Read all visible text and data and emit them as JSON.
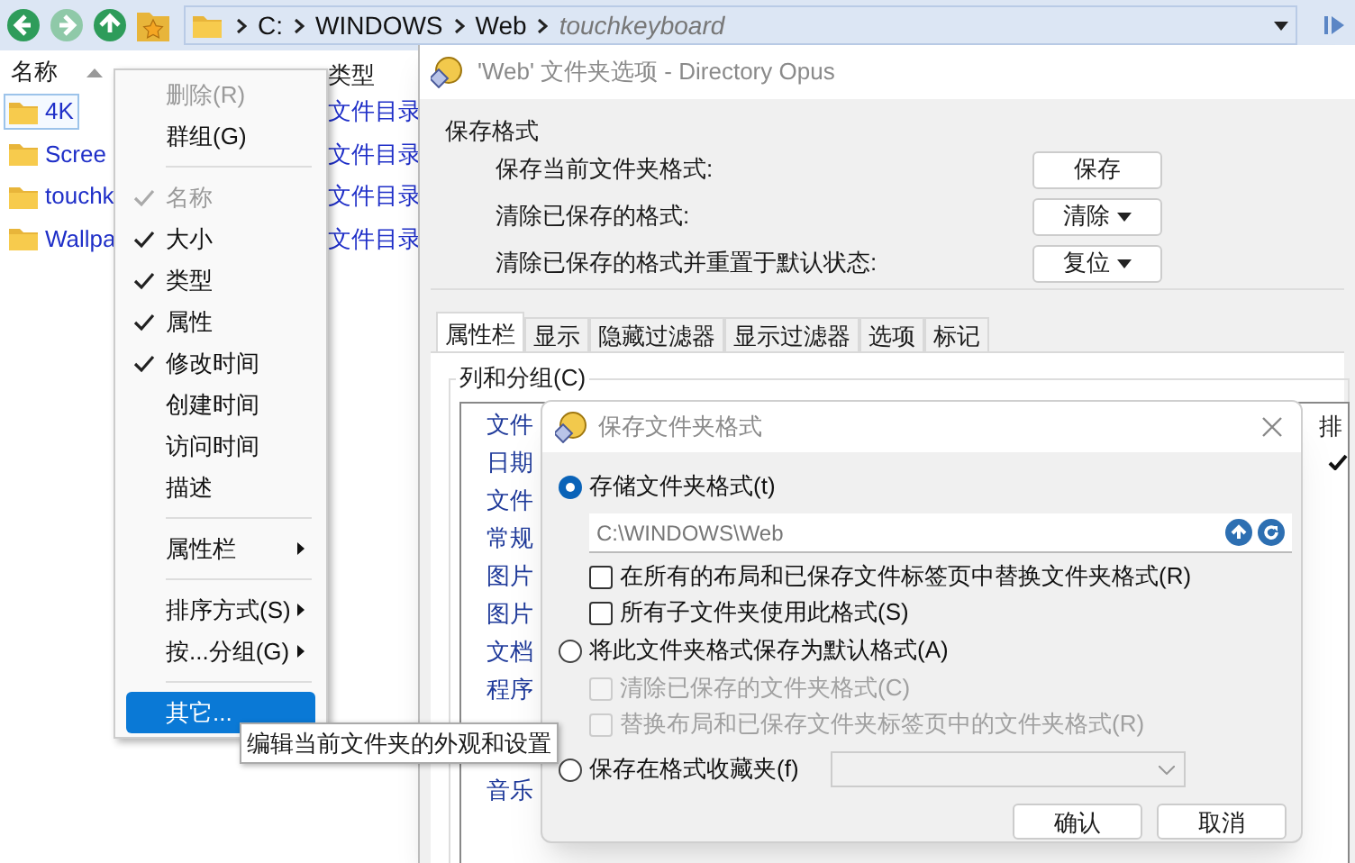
{
  "toolbar": {
    "nav_buttons": [
      {
        "kind": "back",
        "disabled": false
      },
      {
        "kind": "forward",
        "disabled": true
      },
      {
        "kind": "up",
        "disabled": false
      },
      {
        "kind": "favorites",
        "disabled": false
      }
    ],
    "breadcrumb": [
      {
        "text": "C:",
        "current": false
      },
      {
        "text": "WINDOWS",
        "current": false
      },
      {
        "text": "Web",
        "current": false
      },
      {
        "text": "touchkeyboard",
        "current": true
      }
    ]
  },
  "file_list": {
    "columns": [
      "名称",
      "类型"
    ],
    "rows": [
      {
        "name": "4K",
        "type": "文件目录",
        "selected": true
      },
      {
        "name": "Scree",
        "type": "文件目录",
        "selected": false
      },
      {
        "name": "touchk",
        "type": "文件目录",
        "selected": false
      },
      {
        "name": "Wallpa",
        "type": "文件目录",
        "selected": false
      }
    ]
  },
  "context_menu": {
    "items": [
      {
        "kind": "item",
        "label": "删除(R)",
        "disabled": true,
        "checked": false,
        "submenu": false,
        "selected": false
      },
      {
        "kind": "item",
        "label": "群组(G)",
        "disabled": false,
        "checked": false,
        "submenu": false,
        "selected": false
      },
      {
        "kind": "separator"
      },
      {
        "kind": "item",
        "label": "名称",
        "disabled": true,
        "checked": true,
        "submenu": false,
        "selected": false
      },
      {
        "kind": "item",
        "label": "大小",
        "disabled": false,
        "checked": true,
        "submenu": false,
        "selected": false
      },
      {
        "kind": "item",
        "label": "类型",
        "disabled": false,
        "checked": true,
        "submenu": false,
        "selected": false
      },
      {
        "kind": "item",
        "label": "属性",
        "disabled": false,
        "checked": true,
        "submenu": false,
        "selected": false
      },
      {
        "kind": "item",
        "label": "修改时间",
        "disabled": false,
        "checked": true,
        "submenu": false,
        "selected": false
      },
      {
        "kind": "item",
        "label": "创建时间",
        "disabled": false,
        "checked": false,
        "submenu": false,
        "selected": false
      },
      {
        "kind": "item",
        "label": "访问时间",
        "disabled": false,
        "checked": false,
        "submenu": false,
        "selected": false
      },
      {
        "kind": "item",
        "label": "描述",
        "disabled": false,
        "checked": false,
        "submenu": false,
        "selected": false
      },
      {
        "kind": "separator"
      },
      {
        "kind": "item",
        "label": "属性栏",
        "disabled": false,
        "checked": false,
        "submenu": true,
        "selected": false
      },
      {
        "kind": "separator"
      },
      {
        "kind": "item",
        "label": "排序方式(S)",
        "disabled": false,
        "checked": false,
        "submenu": true,
        "selected": false
      },
      {
        "kind": "item",
        "label": "按...分组(G)",
        "disabled": false,
        "checked": false,
        "submenu": true,
        "selected": false
      },
      {
        "kind": "separator"
      },
      {
        "kind": "item",
        "label": "其它...",
        "disabled": false,
        "checked": false,
        "submenu": false,
        "selected": true
      }
    ]
  },
  "tooltip": "编辑当前文件夹的外观和设置",
  "options_window": {
    "title": "'Web' 文件夹选项 - Directory Opus",
    "save_format": {
      "title": "保存格式",
      "rows": [
        {
          "label": "保存当前文件夹格式:",
          "button": "保存",
          "dropdown": false
        },
        {
          "label": "清除已保存的格式:",
          "button": "清除",
          "dropdown": true
        },
        {
          "label": "清除已保存的格式并重置于默认状态:",
          "button": "复位",
          "dropdown": true
        }
      ]
    },
    "tabs": [
      {
        "label": "属性栏",
        "selected": true
      },
      {
        "label": "显示",
        "selected": false
      },
      {
        "label": "隐藏过滤器",
        "selected": false
      },
      {
        "label": "显示过滤器",
        "selected": false
      },
      {
        "label": "选项",
        "selected": false
      },
      {
        "label": "标记",
        "selected": false
      }
    ],
    "columns_group": {
      "title": "列和分组(C)",
      "items": [
        "文件",
        "日期",
        "文件",
        "常规",
        "图片",
        "图片",
        "文档",
        "程序",
        "音乐"
      ],
      "column_2": "排"
    }
  },
  "dialog": {
    "title": "保存文件夹格式",
    "options": [
      {
        "kind": "radio",
        "label": "存储文件夹格式(t)",
        "checked": true
      },
      {
        "kind": "path",
        "value": "C:\\WINDOWS\\Web"
      },
      {
        "kind": "checkbox",
        "label": "在所有的布局和已保存文件标签页中替换文件夹格式(R)",
        "checked": false,
        "disabled": false
      },
      {
        "kind": "checkbox",
        "label": "所有子文件夹使用此格式(S)",
        "checked": false,
        "disabled": false
      },
      {
        "kind": "radio",
        "label": "将此文件夹格式保存为默认格式(A)",
        "checked": false
      },
      {
        "kind": "checkbox",
        "label": "清除已保存的文件夹格式(C)",
        "checked": false,
        "disabled": true
      },
      {
        "kind": "checkbox",
        "label": "替换布局和已保存文件夹标签页中的文件夹格式(R)",
        "checked": false,
        "disabled": true
      },
      {
        "kind": "radio_combo",
        "label": "保存在格式收藏夹(f)",
        "checked": false
      }
    ],
    "buttons": [
      "确认",
      "取消"
    ]
  }
}
